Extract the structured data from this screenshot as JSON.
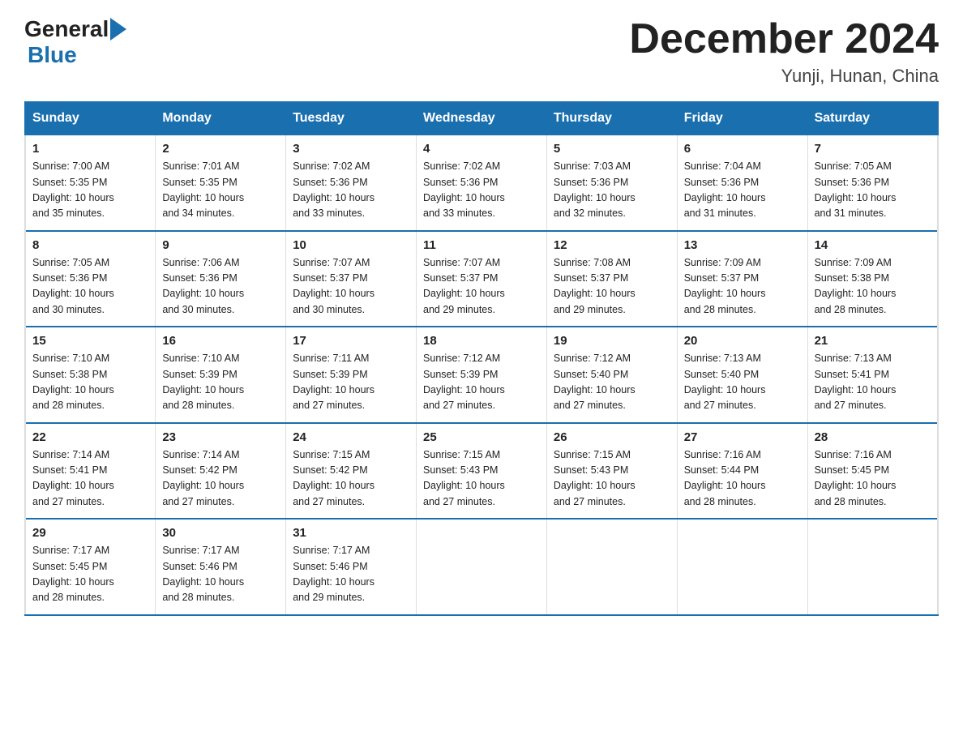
{
  "header": {
    "logo_general": "General",
    "logo_blue": "Blue",
    "month_title": "December 2024",
    "subtitle": "Yunji, Hunan, China"
  },
  "columns": [
    "Sunday",
    "Monday",
    "Tuesday",
    "Wednesday",
    "Thursday",
    "Friday",
    "Saturday"
  ],
  "weeks": [
    [
      {
        "day": "1",
        "sunrise": "7:00 AM",
        "sunset": "5:35 PM",
        "daylight": "10 hours and 35 minutes."
      },
      {
        "day": "2",
        "sunrise": "7:01 AM",
        "sunset": "5:35 PM",
        "daylight": "10 hours and 34 minutes."
      },
      {
        "day": "3",
        "sunrise": "7:02 AM",
        "sunset": "5:36 PM",
        "daylight": "10 hours and 33 minutes."
      },
      {
        "day": "4",
        "sunrise": "7:02 AM",
        "sunset": "5:36 PM",
        "daylight": "10 hours and 33 minutes."
      },
      {
        "day": "5",
        "sunrise": "7:03 AM",
        "sunset": "5:36 PM",
        "daylight": "10 hours and 32 minutes."
      },
      {
        "day": "6",
        "sunrise": "7:04 AM",
        "sunset": "5:36 PM",
        "daylight": "10 hours and 31 minutes."
      },
      {
        "day": "7",
        "sunrise": "7:05 AM",
        "sunset": "5:36 PM",
        "daylight": "10 hours and 31 minutes."
      }
    ],
    [
      {
        "day": "8",
        "sunrise": "7:05 AM",
        "sunset": "5:36 PM",
        "daylight": "10 hours and 30 minutes."
      },
      {
        "day": "9",
        "sunrise": "7:06 AM",
        "sunset": "5:36 PM",
        "daylight": "10 hours and 30 minutes."
      },
      {
        "day": "10",
        "sunrise": "7:07 AM",
        "sunset": "5:37 PM",
        "daylight": "10 hours and 30 minutes."
      },
      {
        "day": "11",
        "sunrise": "7:07 AM",
        "sunset": "5:37 PM",
        "daylight": "10 hours and 29 minutes."
      },
      {
        "day": "12",
        "sunrise": "7:08 AM",
        "sunset": "5:37 PM",
        "daylight": "10 hours and 29 minutes."
      },
      {
        "day": "13",
        "sunrise": "7:09 AM",
        "sunset": "5:37 PM",
        "daylight": "10 hours and 28 minutes."
      },
      {
        "day": "14",
        "sunrise": "7:09 AM",
        "sunset": "5:38 PM",
        "daylight": "10 hours and 28 minutes."
      }
    ],
    [
      {
        "day": "15",
        "sunrise": "7:10 AM",
        "sunset": "5:38 PM",
        "daylight": "10 hours and 28 minutes."
      },
      {
        "day": "16",
        "sunrise": "7:10 AM",
        "sunset": "5:39 PM",
        "daylight": "10 hours and 28 minutes."
      },
      {
        "day": "17",
        "sunrise": "7:11 AM",
        "sunset": "5:39 PM",
        "daylight": "10 hours and 27 minutes."
      },
      {
        "day": "18",
        "sunrise": "7:12 AM",
        "sunset": "5:39 PM",
        "daylight": "10 hours and 27 minutes."
      },
      {
        "day": "19",
        "sunrise": "7:12 AM",
        "sunset": "5:40 PM",
        "daylight": "10 hours and 27 minutes."
      },
      {
        "day": "20",
        "sunrise": "7:13 AM",
        "sunset": "5:40 PM",
        "daylight": "10 hours and 27 minutes."
      },
      {
        "day": "21",
        "sunrise": "7:13 AM",
        "sunset": "5:41 PM",
        "daylight": "10 hours and 27 minutes."
      }
    ],
    [
      {
        "day": "22",
        "sunrise": "7:14 AM",
        "sunset": "5:41 PM",
        "daylight": "10 hours and 27 minutes."
      },
      {
        "day": "23",
        "sunrise": "7:14 AM",
        "sunset": "5:42 PM",
        "daylight": "10 hours and 27 minutes."
      },
      {
        "day": "24",
        "sunrise": "7:15 AM",
        "sunset": "5:42 PM",
        "daylight": "10 hours and 27 minutes."
      },
      {
        "day": "25",
        "sunrise": "7:15 AM",
        "sunset": "5:43 PM",
        "daylight": "10 hours and 27 minutes."
      },
      {
        "day": "26",
        "sunrise": "7:15 AM",
        "sunset": "5:43 PM",
        "daylight": "10 hours and 27 minutes."
      },
      {
        "day": "27",
        "sunrise": "7:16 AM",
        "sunset": "5:44 PM",
        "daylight": "10 hours and 28 minutes."
      },
      {
        "day": "28",
        "sunrise": "7:16 AM",
        "sunset": "5:45 PM",
        "daylight": "10 hours and 28 minutes."
      }
    ],
    [
      {
        "day": "29",
        "sunrise": "7:17 AM",
        "sunset": "5:45 PM",
        "daylight": "10 hours and 28 minutes."
      },
      {
        "day": "30",
        "sunrise": "7:17 AM",
        "sunset": "5:46 PM",
        "daylight": "10 hours and 28 minutes."
      },
      {
        "day": "31",
        "sunrise": "7:17 AM",
        "sunset": "5:46 PM",
        "daylight": "10 hours and 29 minutes."
      },
      null,
      null,
      null,
      null
    ]
  ],
  "labels": {
    "sunrise": "Sunrise:",
    "sunset": "Sunset:",
    "daylight": "Daylight:"
  }
}
